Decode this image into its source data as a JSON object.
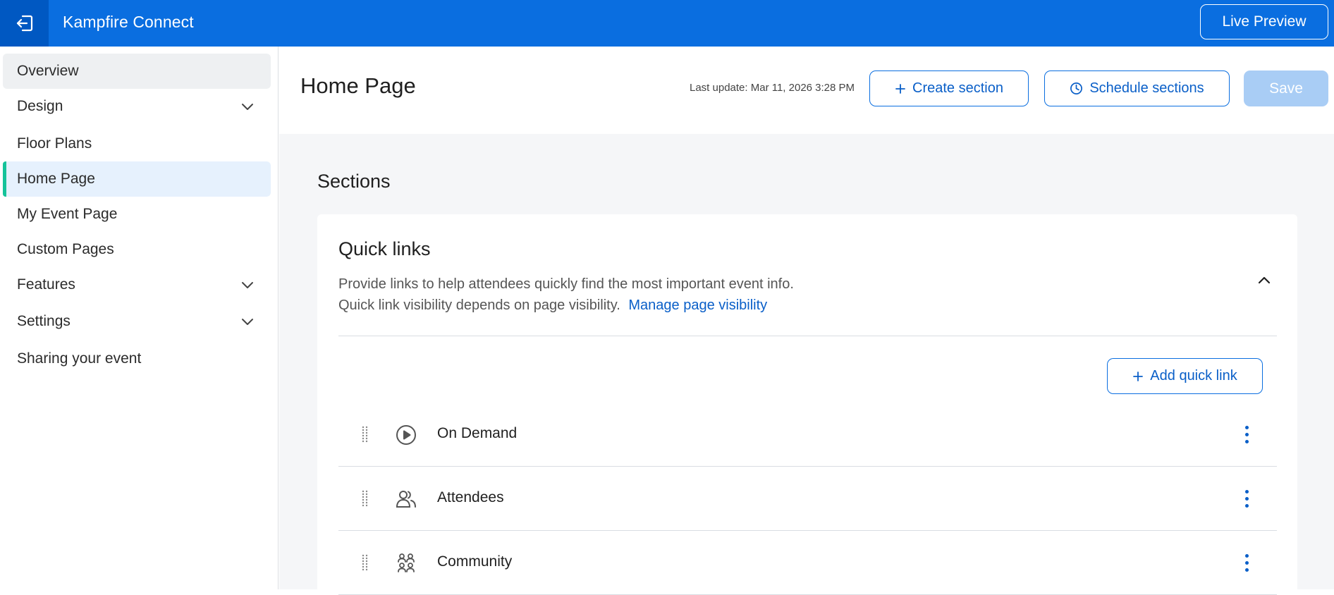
{
  "topbar": {
    "app_title": "Kampfire Connect",
    "exit_icon": "exit-icon",
    "live_preview_label": "Live Preview",
    "background_color": "#0a6ee0"
  },
  "sidebar": {
    "items": [
      {
        "label": "Overview",
        "state": "hovered"
      },
      {
        "label": "Design",
        "expandable": true
      },
      {
        "label": "Floor Plans"
      },
      {
        "label": "Home Page",
        "state": "active"
      },
      {
        "label": "My Event Page"
      },
      {
        "label": "Custom Pages"
      },
      {
        "label": "Features",
        "expandable": true
      },
      {
        "label": "Settings",
        "expandable": true
      },
      {
        "label": "Sharing your event"
      }
    ],
    "active_accent_color": "#15c39a"
  },
  "header": {
    "page_title": "Home Page",
    "last_update": "Last update: Mar 11, 2026 3:28 PM",
    "create_section_label": "Create section",
    "schedule_sections_label": "Schedule sections",
    "save_label": "Save",
    "save_enabled": false
  },
  "main": {
    "sections_title": "Sections",
    "quick_links": {
      "title": "Quick links",
      "description_line1": "Provide links to help attendees quickly find the most important event info.",
      "description_line2": "Quick link visibility depends on page visibility.",
      "manage_link_label": "Manage page visibility",
      "expanded": true,
      "add_label": "Add quick link",
      "items": [
        {
          "label": "On Demand",
          "icon": "play-circle-icon"
        },
        {
          "label": "Attendees",
          "icon": "attendees-icon"
        },
        {
          "label": "Community",
          "icon": "community-icon"
        }
      ]
    }
  }
}
